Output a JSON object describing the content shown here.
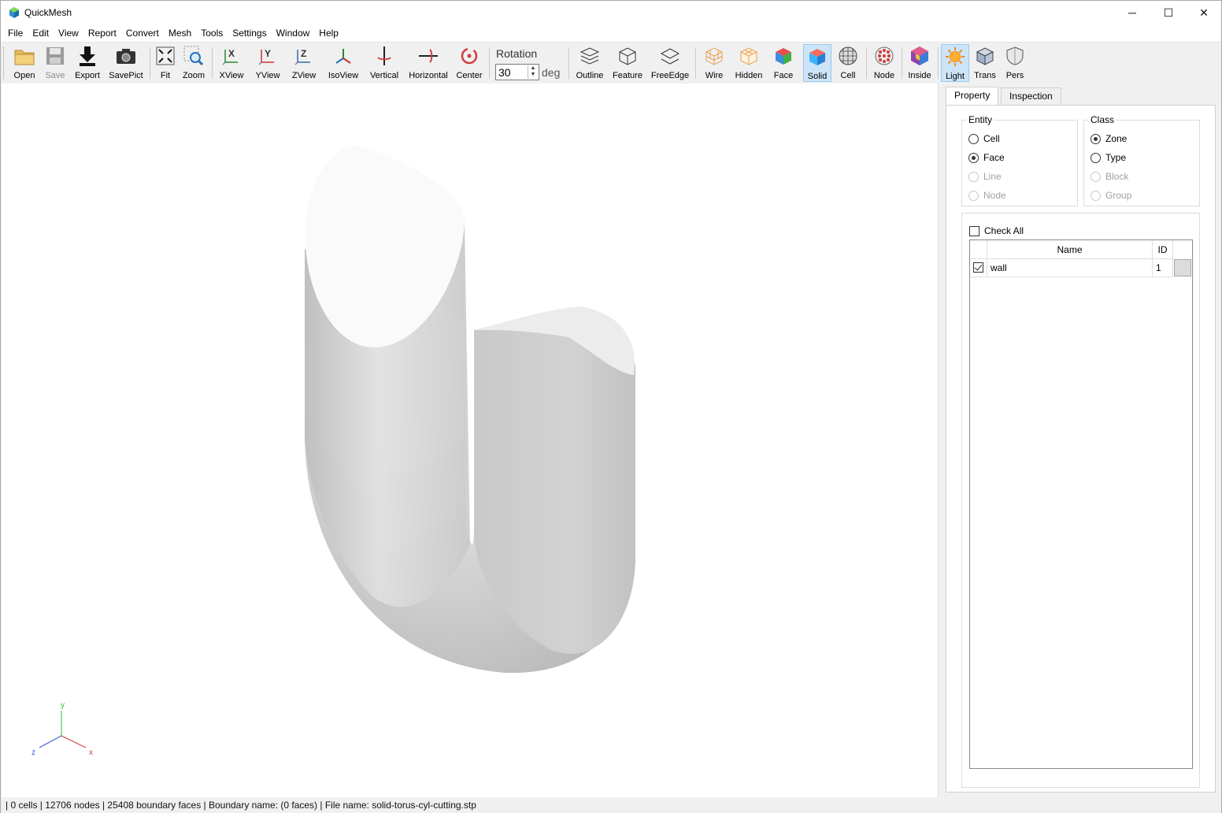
{
  "window": {
    "title": "QuickMesh",
    "minimize": "─",
    "maximize": "☐",
    "close": "✕"
  },
  "menu": [
    "File",
    "Edit",
    "View",
    "Report",
    "Convert",
    "Mesh",
    "Tools",
    "Settings",
    "Window",
    "Help"
  ],
  "toolbar": {
    "open": "Open",
    "save": "Save",
    "export": "Export",
    "savepict": "SavePict",
    "fit": "Fit",
    "zoom": "Zoom",
    "xview": "XView",
    "yview": "YView",
    "zview": "ZView",
    "isoview": "IsoView",
    "vertical": "Vertical",
    "horizontal": "Horizontal",
    "center": "Center",
    "rotation_label": "Rotation",
    "rotation_value": "30",
    "rotation_unit": "deg",
    "outline": "Outline",
    "feature": "Feature",
    "freeedge": "FreeEdge",
    "wire": "Wire",
    "hidden": "Hidden",
    "face": "Face",
    "solid": "Solid",
    "cell": "Cell",
    "node": "Node",
    "inside": "Inside",
    "light": "Light",
    "trans": "Trans",
    "pers": "Pers"
  },
  "axes": {
    "y": "y",
    "x": "x",
    "z": "z"
  },
  "panel": {
    "tabs": {
      "property": "Property",
      "inspection": "Inspection"
    },
    "entity": {
      "title": "Entity",
      "options": [
        "Cell",
        "Face",
        "Line",
        "Node"
      ],
      "selected": "Face"
    },
    "class": {
      "title": "Class",
      "options": [
        "Zone",
        "Type",
        "Block",
        "Group"
      ],
      "selected": "Zone"
    },
    "check_all": "Check All",
    "grid": {
      "headers": {
        "name": "Name",
        "id": "ID"
      },
      "rows": [
        {
          "checked": true,
          "name": "wall",
          "id": "1"
        }
      ]
    }
  },
  "status": "| 0 cells | 12706 nodes | 25408 boundary faces |  Boundary name:  (0 faces) | File name: solid-torus-cyl-cutting.stp",
  "colors": {
    "accent": "#cce4f7",
    "accent_border": "#99c9ef"
  }
}
